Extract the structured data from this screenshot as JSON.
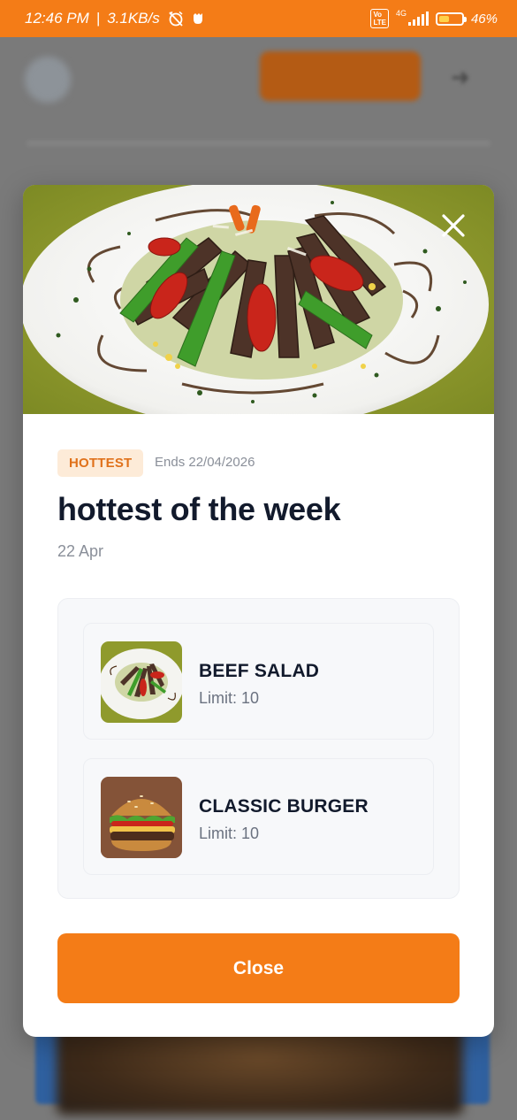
{
  "status_bar": {
    "time": "12:46 PM",
    "speed": "3.1KB/s",
    "battery_percent": "46%",
    "network_label": "4G",
    "lte_label": "Vo LTE",
    "battery_level": 0.46
  },
  "modal": {
    "badge": "HOTTEST",
    "ends": "Ends 22/04/2026",
    "title": "hottest of the week",
    "date": "22 Apr",
    "items": [
      {
        "name": "BEEF SALAD",
        "limit": "Limit: 10"
      },
      {
        "name": "CLASSIC BURGER",
        "limit": "Limit: 10"
      }
    ],
    "close_button": "Close",
    "close_icon": "close-icon"
  },
  "colors": {
    "accent": "#f47c17",
    "badge_bg": "#fdebd8",
    "badge_text": "#e0711a",
    "title": "#121a2c"
  }
}
